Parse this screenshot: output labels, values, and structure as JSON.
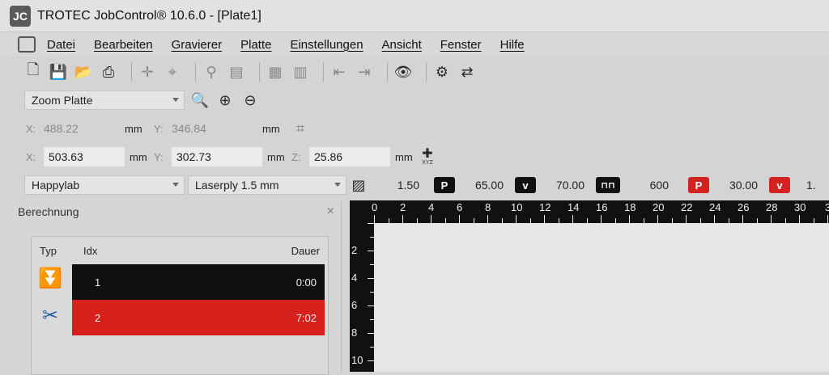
{
  "window": {
    "title": "TROTEC JobControl® 10.6.0 - [Plate1]",
    "icon_text": "JC"
  },
  "menu": [
    "Datei",
    "Bearbeiten",
    "Gravierer",
    "Platte",
    "Einstellungen",
    "Ansicht",
    "Fenster",
    "Hilfe"
  ],
  "zoom": {
    "value": "Zoom Platte"
  },
  "coords_row1": {
    "x_label": "X:",
    "x_value": "488.22",
    "x_unit": "mm",
    "y_label": "Y:",
    "y_value": "346.84",
    "y_unit": "mm"
  },
  "coords_row2": {
    "x_label": "X:",
    "x_value": "503.63",
    "x_unit": "mm",
    "y_label": "Y:",
    "y_value": "302.73",
    "y_unit": "mm",
    "z_label": "Z:",
    "z_value": "25.86",
    "z_unit": "mm",
    "xyz_label": "XYZ"
  },
  "params": {
    "material_group": "Happylab",
    "material": "Laserply 1.5 mm",
    "thickness": "1.50",
    "p1_badge": "P",
    "p1_value": "65.00",
    "v1_badge": "v",
    "v1_value": "70.00",
    "freq_value": "600",
    "p2_badge": "P",
    "p2_value": "30.00",
    "v2_badge": "v",
    "v2_partial": "1."
  },
  "panel": {
    "title": "Berechnung",
    "close": "×",
    "headers": {
      "typ": "Typ",
      "idx": "Idx",
      "dauer": "Dauer"
    },
    "rows": [
      {
        "idx": "1",
        "dauer": "0:00",
        "color": "#101010"
      },
      {
        "idx": "2",
        "dauer": "7:02",
        "color": "#d6201c"
      }
    ]
  },
  "ruler": {
    "top_labels": [
      "0",
      "2",
      "4",
      "6",
      "8",
      "10",
      "12",
      "14",
      "16",
      "18",
      "20",
      "22",
      "24",
      "26",
      "28",
      "30",
      "3"
    ],
    "left_labels": [
      "2",
      "4",
      "6",
      "8",
      "10"
    ]
  }
}
